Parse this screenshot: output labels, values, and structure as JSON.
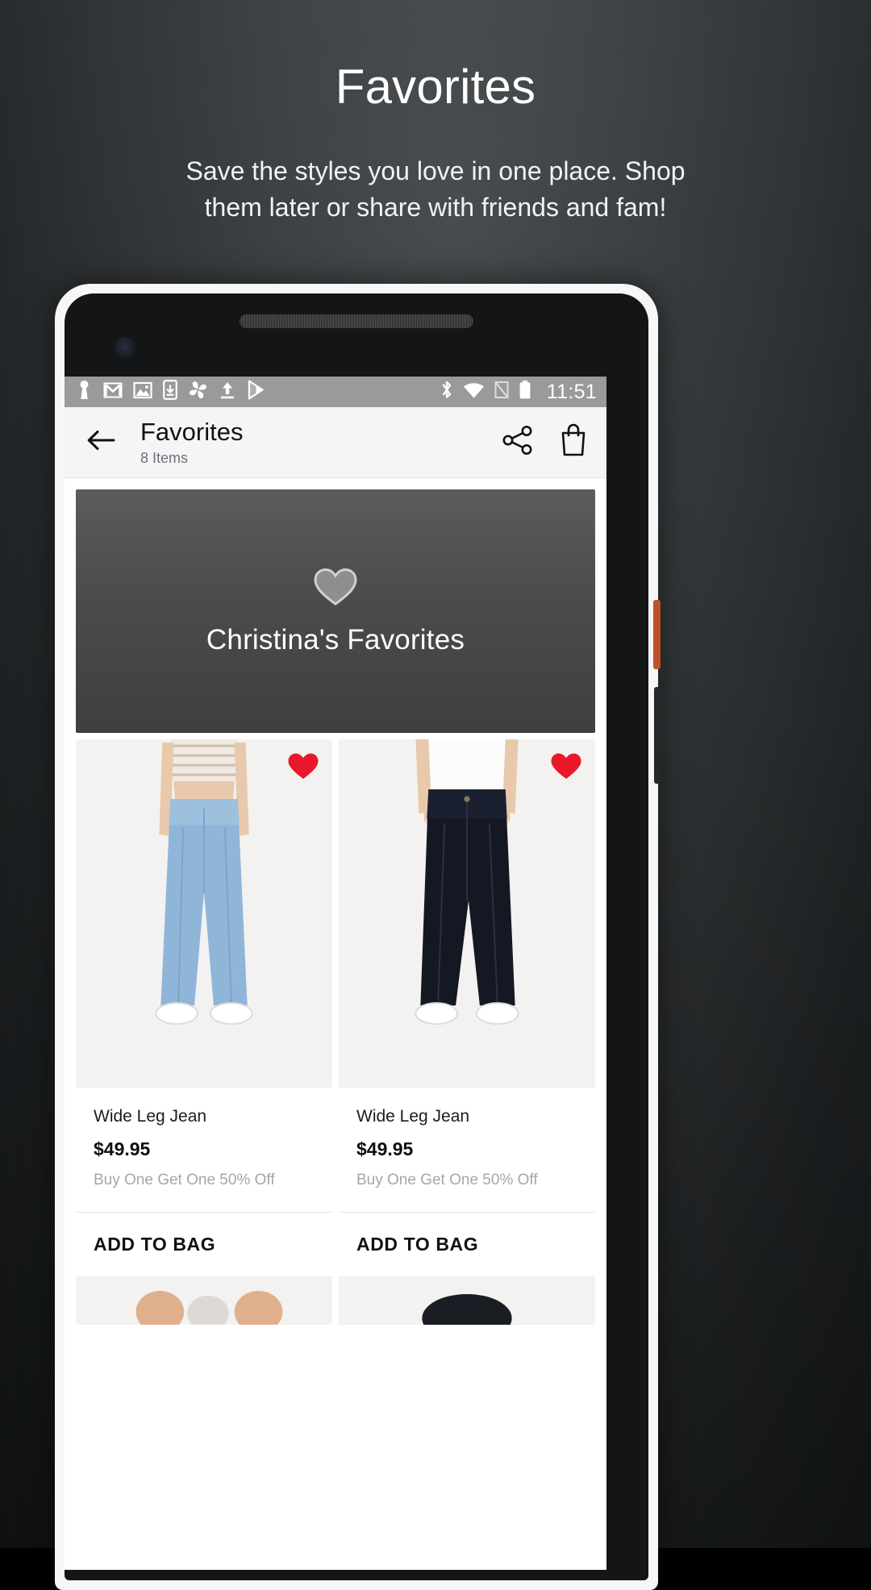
{
  "promo": {
    "title": "Favorites",
    "subtitle": "Save the styles you love in one place. Shop them later or share with friends and fam!"
  },
  "colors": {
    "promo_background": "#34383a",
    "status_bar": "#9a9a9a",
    "app_bar": "#f5f5f7",
    "banner_gradient_top": "#5a5c5e",
    "banner_gradient_bottom": "#3d3f41",
    "heart_red": "#e8182a",
    "price_text": "#0e0f11",
    "promo_text": "#a6a6aa",
    "side_button_orange": "#c0502a"
  },
  "phone": {
    "status_bar": {
      "left_icons": [
        "person-icon",
        "gmail-icon",
        "photo-icon",
        "phone-download-icon",
        "pinwheel-photos-icon",
        "upload-icon",
        "play-store-icon"
      ],
      "right_icons": [
        "bluetooth-icon",
        "wifi-icon",
        "sim-off-icon",
        "battery-icon"
      ],
      "time": "11:51"
    },
    "app_bar": {
      "back_icon": "arrow-left-icon",
      "title": "Favorites",
      "subtitle": "8 Items",
      "share_icon": "share-icon",
      "bag_icon": "shopping-bag-icon"
    },
    "collection_banner": {
      "heart_icon": "heart-outline-icon",
      "name": "Christina's Favorites"
    },
    "products": [
      {
        "name": "Wide Leg Jean",
        "price": "$49.95",
        "promo": "Buy One Get One 50% Off",
        "add_to_bag_label": "ADD TO BAG",
        "favorited_icon": "heart-filled-icon",
        "wash": "light"
      },
      {
        "name": "Wide Leg Jean",
        "price": "$49.95",
        "promo": "Buy One Get One 50% Off",
        "add_to_bag_label": "ADD TO BAG",
        "favorited_icon": "heart-filled-icon",
        "wash": "dark"
      }
    ]
  }
}
